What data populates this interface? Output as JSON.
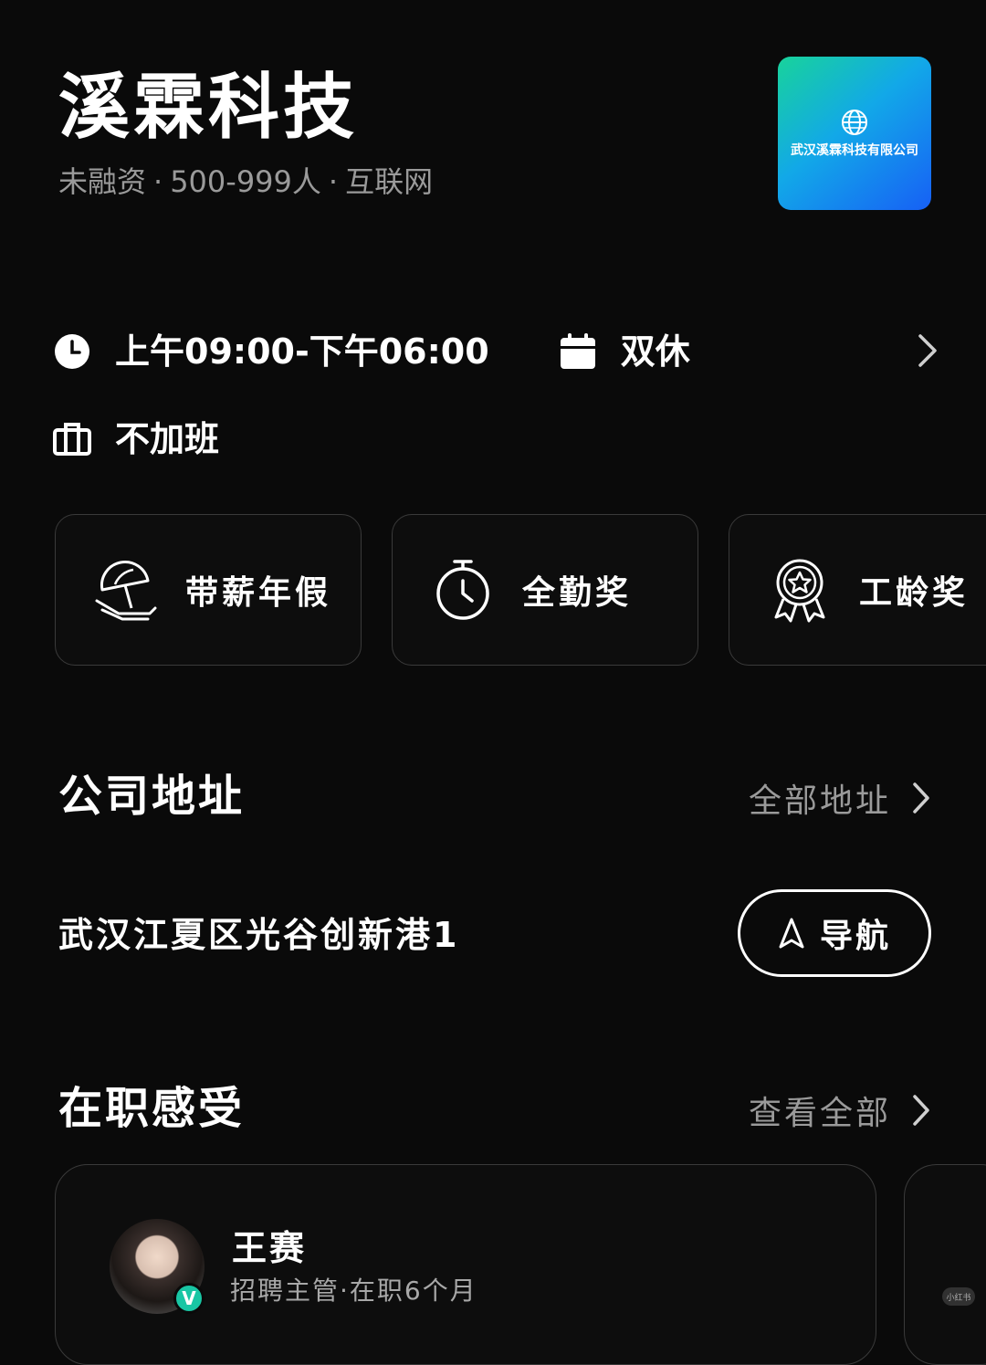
{
  "header": {
    "company_name": "溪霖科技",
    "funding": "未融资",
    "size": "500-999人",
    "industry": "互联网",
    "separator": "·",
    "logo_text": "武汉溪霖科技有限公司"
  },
  "work_info": {
    "hours": "上午09:00-下午06:00",
    "rest": "双休",
    "overtime": "不加班"
  },
  "benefits": [
    {
      "label": "带薪年假",
      "icon": "beach-umbrella-icon"
    },
    {
      "label": "全勤奖",
      "icon": "stopwatch-icon"
    },
    {
      "label": "工龄奖",
      "icon": "award-badge-icon"
    }
  ],
  "address_section": {
    "title": "公司地址",
    "link_label": "全部地址",
    "address": "武汉江夏区光谷创新港1",
    "nav_label": "导航"
  },
  "reviews_section": {
    "title": "在职感受",
    "link_label": "查看全部",
    "reviews": [
      {
        "name": "王赛",
        "meta": "招聘主管·在职6个月",
        "badge": "V"
      }
    ]
  },
  "watermark": "小红书",
  "colors": {
    "background": "#0a0a0a",
    "muted_text": "#9a9a9a",
    "card_border": "#3a3a3a",
    "logo_gradient_start": "#18d39b",
    "logo_gradient_end": "#1760f5",
    "verified_badge": "#19c6a4"
  }
}
